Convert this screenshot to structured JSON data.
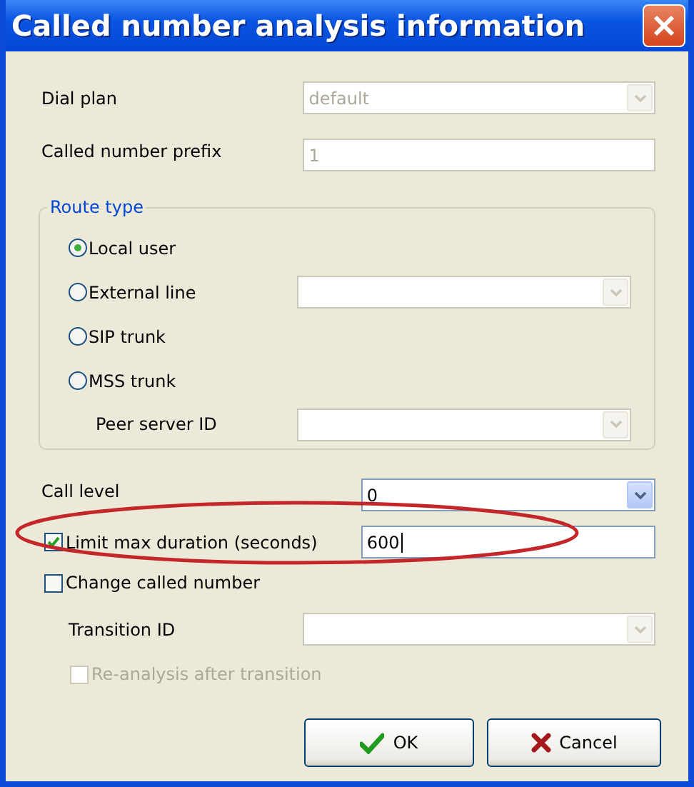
{
  "window": {
    "title": "Called number analysis information"
  },
  "dial_plan": {
    "label": "Dial plan",
    "value": "default",
    "disabled": true
  },
  "called_number_prefix": {
    "label": "Called number prefix",
    "value": "1",
    "disabled": true
  },
  "route_type": {
    "title": "Route type",
    "options": [
      {
        "label": "Local user",
        "selected": true
      },
      {
        "label": "External line",
        "selected": false
      },
      {
        "label": "SIP trunk",
        "selected": false
      },
      {
        "label": "MSS trunk",
        "selected": false
      }
    ],
    "external_line": {
      "disabled": true
    },
    "peer_server_id": {
      "label": "Peer server ID",
      "disabled": true
    }
  },
  "call_level": {
    "label": "Call level",
    "value": "0",
    "disabled": false
  },
  "limit_max_duration": {
    "label": "Limit max duration (seconds)",
    "checked": true,
    "value": "600"
  },
  "change_called_number": {
    "label": "Change called number",
    "checked": false
  },
  "transition_id": {
    "label": "Transition ID",
    "disabled": true
  },
  "re_analysis": {
    "label": "Re-analysis after transition",
    "checked": false,
    "disabled": true
  },
  "buttons": [
    {
      "label": "OK",
      "kind": "ok"
    },
    {
      "label": "Cancel",
      "kind": "cancel"
    }
  ]
}
